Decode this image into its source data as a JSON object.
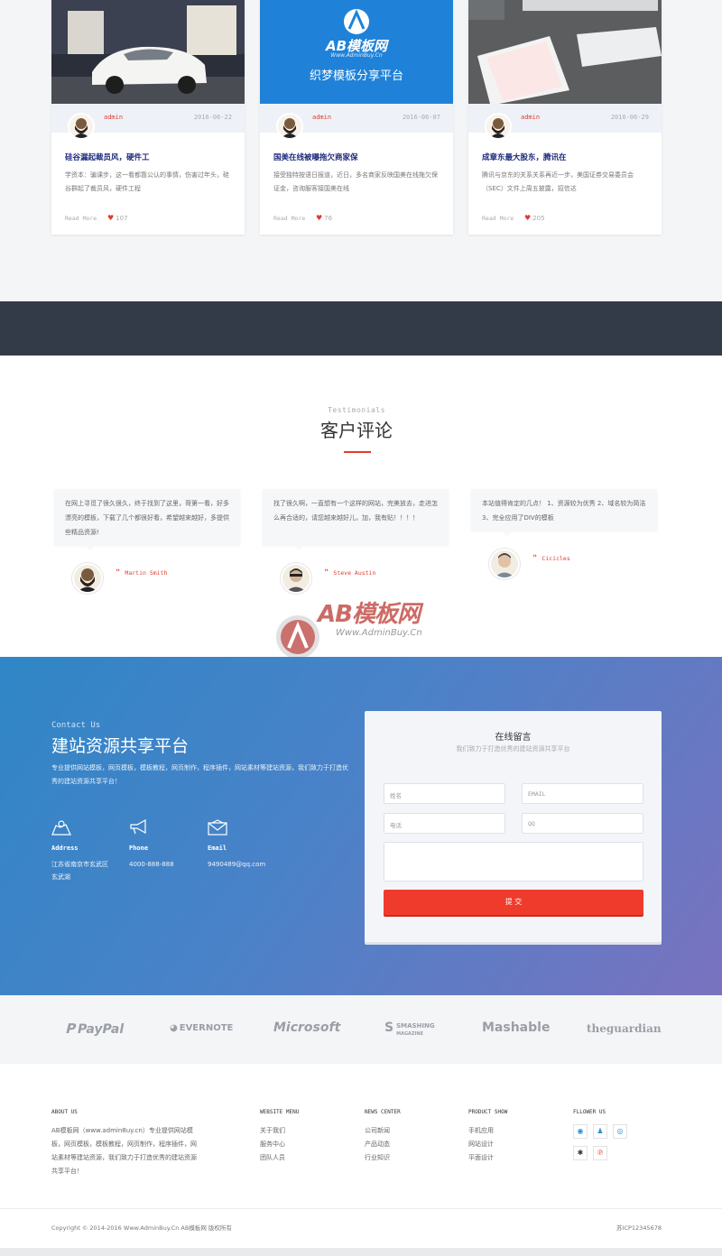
{
  "blog": {
    "cards": [
      {
        "author": "admin",
        "date": "2016-06-22",
        "title": "硅谷漏起裁员风，硬件工",
        "excerpt": "学资本：骗课步，这一看都靠公认的事情，伤害过年头，硅谷群起了裁员风，硬件工程",
        "readmore": "Read More",
        "likes": "107"
      },
      {
        "author": "admin",
        "date": "2016-06-07",
        "title": "国美在线被曝拖欠商家保",
        "excerpt": "接受独特按语日报道，近日，多名商家反映国美在线拖欠保证金，咨询服客接国美在线",
        "readmore": "Read More",
        "likes": "76",
        "banner_logo": "AB模板网",
        "banner_url": "Www.AdminBuy.Cn",
        "banner_caption": "织梦模板分享平台"
      },
      {
        "author": "admin",
        "date": "2016-06-29",
        "title": "成章东最大股东，腾讯在",
        "excerpt": "腾讯与京东的关系关系再近一步，美国证券交易委员会（SEC）文件上周五披露，招信达",
        "readmore": "Read More",
        "likes": "205"
      }
    ]
  },
  "testimonials": {
    "sub": "Testimonials",
    "heading": "客户评论",
    "items": [
      {
        "text": "在网上寻觅了很久很久，终于找到了这里，哥第一看，好多漂亮的模板，下载了几个都很好看，希望越来越好，多提供些精品资源!",
        "name": "Martin Smith"
      },
      {
        "text": "找了很久啊，一直想有一个这样的网站，完美放去，走进怎么再合适的，请您越来越好儿，加，我有贴！！！！",
        "name": "Steve Austin"
      },
      {
        "text": "本站值得肯定的几点！ 1、资源较为优秀 2、域名较为简洁 3、完全应用了DIV的模板",
        "name": "Cicicles"
      }
    ]
  },
  "watermark": {
    "logo": "AB模板网",
    "url": "Www.AdminBuy.Cn"
  },
  "contact": {
    "sub": "Contact Us",
    "title": "建站资源共享平台",
    "desc": "专业提供网站模板，网页模板，模板教程，网页制作，程序插件，网站素材等建站资源，我们致力于打造优秀的建站资源共享平台！",
    "address_label": "Address",
    "address": "江苏省南京市玄武区玄武湖",
    "phone_label": "Phone",
    "phone": "4000-888-888",
    "email_label": "Email",
    "email": "9490489@qq.com"
  },
  "form": {
    "title": "在线留言",
    "subtitle": "我们致力于打造优秀的建站资源共享平台",
    "name_ph": "姓名",
    "email_ph": "EMAIL",
    "phone_ph": "电话",
    "qq_ph": "QQ",
    "submit": "提 交"
  },
  "logos": [
    "PayPal",
    "EVERNOTE",
    "Microsoft",
    "SMASHING",
    "Mashable",
    "theguardian"
  ],
  "logo_small": "MAGAZINE",
  "footer": {
    "about_head": "ABOUT US",
    "about_text": "AB模板网（www.admin8uy.cn）专业提供网站模板，网页模板，模板教程，网页制作，程序插件，网站素材等建站资源，我们致力于打造优秀的建站资源共享平台！",
    "website_head": "WEBSITE MENU",
    "website_links": [
      "关于我们",
      "服务中心",
      "团队人员"
    ],
    "news_head": "NEWS CENTER",
    "news_links": [
      "公司新闻",
      "产品动态",
      "行业知识"
    ],
    "product_head": "PRODUCT SHOW",
    "product_links": [
      "手机应用",
      "网站设计",
      "平面设计"
    ],
    "follow_head": "FLLOWER US",
    "copyright": "Copyright © 2014-2016 Www.AdminBuy.Cn AB模板网 版权所有",
    "icp": "苏ICP12345678"
  },
  "colors": {
    "accent": "#e23b2e",
    "dark_band": "#333a48",
    "title_blue": "#1d2a7a"
  }
}
